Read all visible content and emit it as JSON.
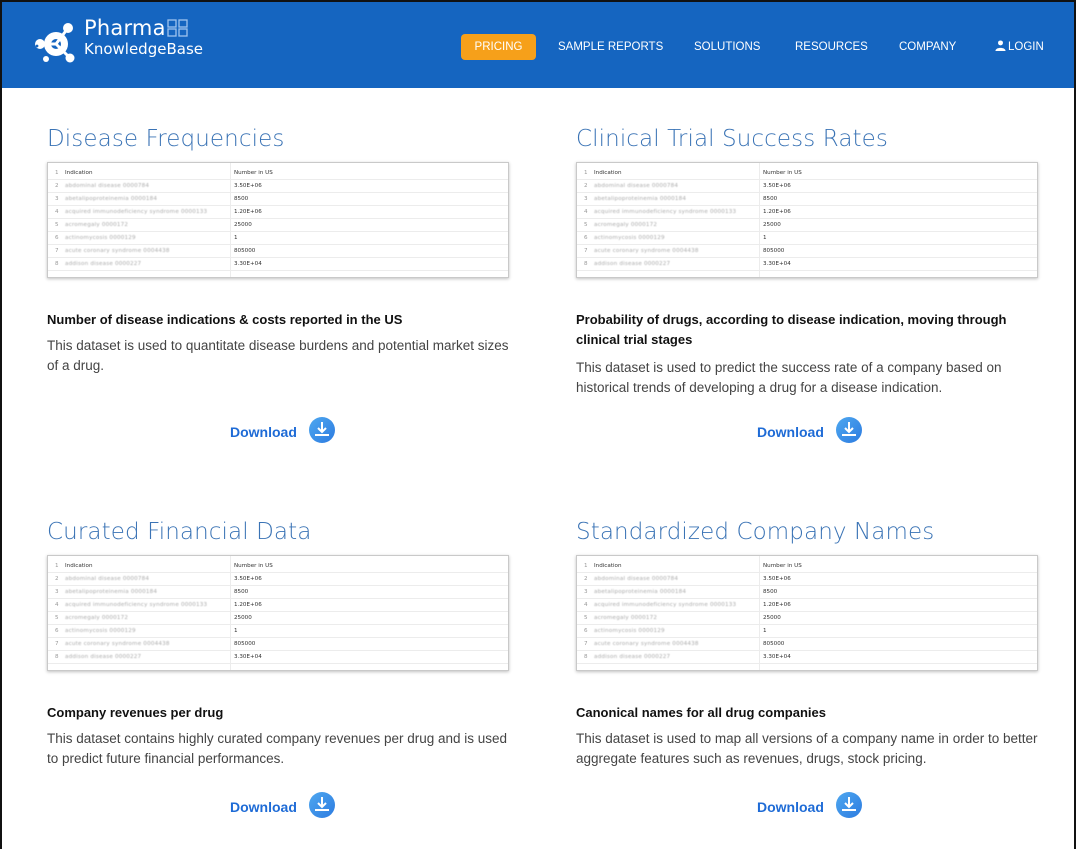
{
  "brand": {
    "name_line1": "Pharma",
    "name_line2": "KnowledgeBase",
    "color": "#1565c0"
  },
  "nav": {
    "pricing": "PRICING",
    "sample_reports": "SAMPLE REPORTS",
    "solutions": "SOLUTIONS",
    "resources": "RESOURCES",
    "company": "COMPANY",
    "login": "LOGIN",
    "active_color": "#f6a01a"
  },
  "thumbnail": {
    "header": {
      "index": "1",
      "indication": "Indication",
      "value": "Number in US"
    },
    "rows": [
      {
        "index": "2",
        "indication": "abdominal disease 0000784",
        "value": "3.50E+06"
      },
      {
        "index": "3",
        "indication": "abetalipoproteinemia 0000184",
        "value": "8500"
      },
      {
        "index": "4",
        "indication": "acquired immunodeficiency syndrome 0000133",
        "value": "1.20E+06"
      },
      {
        "index": "5",
        "indication": "acromegaly 0000172",
        "value": "25000"
      },
      {
        "index": "6",
        "indication": "actinomycosis 0000129",
        "value": "1"
      },
      {
        "index": "7",
        "indication": "acute coronary syndrome 0004438",
        "value": "805000"
      },
      {
        "index": "8",
        "indication": "addison disease 0000227",
        "value": "3.30E+04"
      }
    ]
  },
  "cards": [
    {
      "title": "Disease Frequencies",
      "heading": "Number of disease indications & costs reported in the US",
      "description": "This dataset is used to quantitate disease burdens and potential market sizes of a drug.",
      "download": "Download"
    },
    {
      "title": "Clinical Trial Success Rates",
      "heading": "Probability of drugs, according to disease indication, moving through clinical trial stages",
      "description": "This dataset is used to predict the success rate of a company based on historical trends of developing a drug for a disease indication.",
      "download": "Download"
    },
    {
      "title": "Curated Financial Data",
      "heading": "Company revenues per drug",
      "description": "This dataset contains highly curated company revenues per drug and is used to predict future financial performances.",
      "download": "Download"
    },
    {
      "title": "Standardized Company Names",
      "heading": "Canonical names for all drug companies",
      "description": "This dataset is used to map all versions of a company name in order to better aggregate features such as revenues, drugs, stock pricing.",
      "download": "Download"
    }
  ]
}
